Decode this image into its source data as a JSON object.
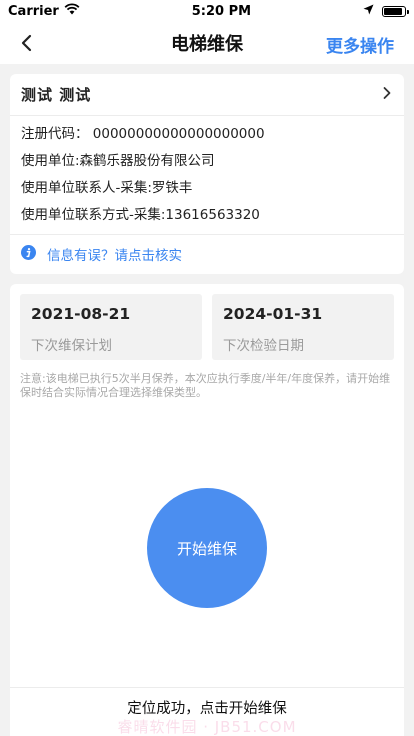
{
  "status_bar": {
    "carrier": "Carrier",
    "time": "5:20 PM",
    "battery_level": 0.9
  },
  "nav": {
    "title": "电梯维保",
    "more_label": "更多操作"
  },
  "info": {
    "header_title": "测试 测试",
    "registration_code": "注册代码： 00000000000000000000",
    "using_unit": "使用单位:森鹤乐器股份有限公司",
    "contact_person": "使用单位联系人-采集:罗铁丰",
    "contact_phone": "使用单位联系方式-采集:13616563320",
    "verify_text": "信息有误？请点击核实"
  },
  "maintenance": {
    "next_plan_date": "2021-08-21",
    "next_plan_label": "下次维保计划",
    "next_inspection_date": "2024-01-31",
    "next_inspection_label": "下次检验日期",
    "notice": "注意:该电梯已执行5次半月保养，本次应执行季度/半年/年度保养，请开始维保时结合实际情况合理选择维保类型。",
    "start_button": "开始维保",
    "location_status": "定位成功，点击开始维保",
    "watermark": "睿晴软件园 · JB51.COM"
  },
  "colors": {
    "accent": "#3a85f0",
    "button": "#4b8ef0",
    "background": "#f2f2f2"
  },
  "icons": [
    "wifi-icon",
    "location-arrow-icon",
    "battery-icon",
    "back-chevron-icon",
    "chevron-right-icon",
    "info-icon"
  ]
}
